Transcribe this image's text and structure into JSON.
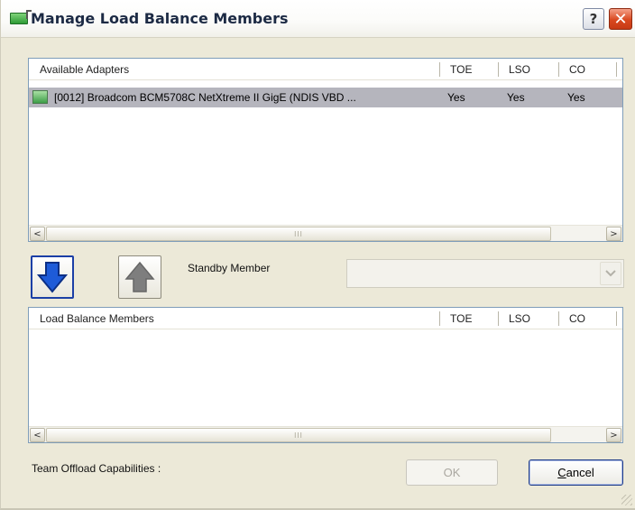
{
  "window": {
    "title": "Manage Load Balance Members",
    "help_label": "?",
    "close_label": "✕"
  },
  "available_adapters": {
    "columns": [
      "Available Adapters",
      "TOE",
      "LSO",
      "CO"
    ],
    "rows": [
      {
        "name": "[0012] Broadcom BCM5708C NetXtreme II GigE (NDIS VBD ...",
        "toe": "Yes",
        "lso": "Yes",
        "co": "Yes",
        "selected": true
      }
    ],
    "scroll_left": "<",
    "scroll_thumb": "III",
    "scroll_right": ">"
  },
  "controls": {
    "add_icon": "blue-down-arrow-icon",
    "remove_icon": "gray-up-arrow-icon",
    "standby_label": "Standby Member",
    "standby_value": "",
    "dropdown_arrow": "chevron-down-icon"
  },
  "load_balance_members": {
    "columns": [
      "Load Balance Members",
      "TOE",
      "LSO",
      "CO"
    ],
    "rows": [],
    "scroll_left": "<",
    "scroll_thumb": "III",
    "scroll_right": ">"
  },
  "footer": {
    "capabilities_label": "Team Offload Capabilities :",
    "ok_label": "OK",
    "cancel_label": "Cancel",
    "cancel_accesskey": "C",
    "cancel_rest": "ancel"
  },
  "colors": {
    "selected_row": "#b5b5bd",
    "accent_arrow": "#1e5bd8",
    "close_button": "#d9481f"
  }
}
